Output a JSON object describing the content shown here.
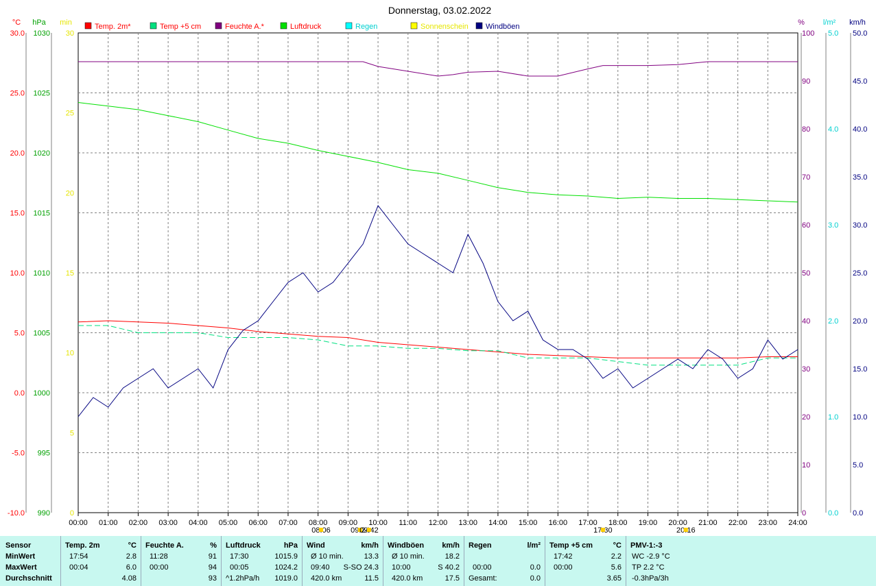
{
  "chart_data": {
    "type": "line",
    "title": "Donnerstag, 03.02.2022",
    "x_ticks": [
      "00:00",
      "01:00",
      "02:00",
      "03:00",
      "04:00",
      "05:00",
      "06:00",
      "07:00",
      "08:00",
      "09:00",
      "10:00",
      "11:00",
      "12:00",
      "13:00",
      "14:00",
      "15:00",
      "16:00",
      "17:00",
      "18:00",
      "19:00",
      "20:00",
      "21:00",
      "22:00",
      "23:00",
      "24:00"
    ],
    "axes": {
      "temp": {
        "unit": "°C",
        "min": -10,
        "max": 30,
        "ticks": [
          "30.0",
          "25.0",
          "20.0",
          "15.0",
          "10.0",
          "5.0",
          "0.0",
          "-5.0",
          "-10.0"
        ],
        "color": "#ff0000"
      },
      "pressure": {
        "unit": "hPa",
        "min": 990,
        "max": 1030,
        "ticks": [
          "1030",
          "1025",
          "1020",
          "1015",
          "1010",
          "1005",
          "1000",
          "995",
          "990"
        ],
        "color": "#00a000"
      },
      "sun": {
        "unit": "min",
        "min": 0,
        "max": 30,
        "ticks": [
          "30",
          "25",
          "20",
          "15",
          "10",
          "5",
          "0"
        ],
        "color": "#e6e600"
      },
      "humidity": {
        "unit": "%",
        "min": 0,
        "max": 100,
        "ticks": [
          "100",
          "90",
          "80",
          "70",
          "60",
          "50",
          "40",
          "30",
          "20",
          "10",
          "0"
        ],
        "color": "#800080"
      },
      "rain": {
        "unit": "l/m²",
        "min": 0,
        "max": 5,
        "ticks": [
          "5.0",
          "4.0",
          "3.0",
          "2.0",
          "1.0",
          "0.0"
        ],
        "color": "#00d0d0"
      },
      "wind": {
        "unit": "km/h",
        "min": 0,
        "max": 50,
        "ticks": [
          "50.0",
          "45.0",
          "40.0",
          "35.0",
          "30.0",
          "25.0",
          "20.0",
          "15.0",
          "10.0",
          "5.0",
          "0.0"
        ],
        "color": "#000080"
      }
    },
    "legend": [
      {
        "name": "Temp. 2m*",
        "color": "#ff0000",
        "text_color": "#ff0000"
      },
      {
        "name": "Temp +5 cm",
        "color": "#00e080",
        "text_color": "#ff0000"
      },
      {
        "name": "Feuchte A.*",
        "color": "#800080",
        "text_color": "#ff0000"
      },
      {
        "name": "Luftdruck",
        "color": "#00e000",
        "text_color": "#ff0000"
      },
      {
        "name": "Regen",
        "color": "#00ffff",
        "text_color": "#00d0d0"
      },
      {
        "name": "Sonnenschein",
        "color": "#ffff00",
        "text_color": "#e6e600"
      },
      {
        "name": "Windböen",
        "color": "#000080",
        "text_color": "#000080"
      }
    ],
    "series": [
      {
        "name": "Temp. 2m*",
        "axis": "temp",
        "color": "#ff0000",
        "x": [
          0,
          1,
          2,
          3,
          4,
          5,
          6,
          7,
          8,
          9,
          10,
          11,
          12,
          13,
          14,
          15,
          16,
          17,
          18,
          19,
          20,
          21,
          22,
          23,
          24
        ],
        "values": [
          5.9,
          6.0,
          5.9,
          5.8,
          5.6,
          5.4,
          5.1,
          4.9,
          4.7,
          4.6,
          4.2,
          4.0,
          3.8,
          3.6,
          3.4,
          3.2,
          3.1,
          3.0,
          2.9,
          2.9,
          2.9,
          2.9,
          2.9,
          3.0,
          3.0
        ]
      },
      {
        "name": "Temp +5 cm",
        "axis": "temp",
        "color": "#00e080",
        "x": [
          0,
          1,
          2,
          3,
          4,
          5,
          6,
          7,
          8,
          9,
          10,
          11,
          12,
          13,
          14,
          15,
          16,
          17,
          18,
          19,
          20,
          21,
          22,
          23,
          24
        ],
        "values": [
          5.6,
          5.6,
          5.0,
          5.0,
          5.0,
          4.6,
          4.6,
          4.6,
          4.4,
          3.9,
          3.9,
          3.7,
          3.7,
          3.5,
          3.5,
          2.9,
          2.9,
          2.9,
          2.6,
          2.3,
          2.3,
          2.3,
          2.3,
          2.9,
          2.9
        ]
      },
      {
        "name": "Feuchte A.*",
        "axis": "humidity",
        "color": "#800080",
        "x": [
          0,
          1,
          2,
          3,
          4,
          5,
          6,
          7,
          8,
          9,
          9.5,
          10,
          11,
          12,
          12.5,
          13,
          14,
          15,
          16,
          17,
          17.5,
          18,
          19,
          20,
          20.5,
          21,
          22,
          23,
          24
        ],
        "values": [
          94,
          94,
          94,
          94,
          94,
          94,
          94,
          94,
          94,
          94,
          94,
          93,
          92,
          91,
          91.3,
          91.8,
          92,
          91,
          91,
          92.5,
          93.2,
          93.2,
          93.2,
          93.4,
          93.7,
          94,
          94,
          94,
          94
        ]
      },
      {
        "name": "Luftdruck",
        "axis": "pressure",
        "color": "#00e000",
        "x": [
          0,
          1,
          2,
          3,
          4,
          5,
          6,
          7,
          8,
          9,
          10,
          11,
          12,
          13,
          14,
          15,
          16,
          17,
          18,
          19,
          20,
          21,
          22,
          23,
          24
        ],
        "values": [
          1024.2,
          1023.9,
          1023.6,
          1023.1,
          1022.6,
          1021.9,
          1021.2,
          1020.8,
          1020.2,
          1019.7,
          1019.2,
          1018.6,
          1018.3,
          1017.7,
          1017.1,
          1016.7,
          1016.5,
          1016.4,
          1016.2,
          1016.3,
          1016.2,
          1016.2,
          1016.1,
          1016.0,
          1015.9
        ]
      },
      {
        "name": "Windböen",
        "axis": "wind",
        "color": "#000080",
        "x": [
          0,
          0.5,
          1,
          1.5,
          2,
          2.5,
          3,
          3.5,
          4,
          4.5,
          5,
          5.5,
          6,
          6.5,
          7,
          7.5,
          8,
          8.5,
          9,
          9.5,
          10,
          10.5,
          11,
          11.5,
          12,
          12.5,
          13,
          13.5,
          14,
          14.5,
          15,
          15.5,
          16,
          16.5,
          17,
          17.5,
          18,
          18.5,
          19,
          19.5,
          20,
          20.5,
          21,
          21.5,
          22,
          22.5,
          23,
          23.5,
          24
        ],
        "values": [
          10,
          12,
          11,
          13,
          14,
          15,
          13,
          14,
          15,
          13,
          17,
          19,
          20,
          22,
          24,
          25,
          23,
          24,
          26,
          28,
          32,
          30,
          28,
          27,
          26,
          25,
          29,
          26,
          22,
          20,
          21,
          18,
          17,
          17,
          16,
          14,
          15,
          13,
          14,
          15,
          16,
          15,
          17,
          16,
          14,
          15,
          18,
          16,
          17
        ]
      }
    ],
    "markers": [
      {
        "time": "09:24",
        "label": "09:24"
      },
      {
        "time": "08:06",
        "label": "08:06"
      },
      {
        "time": "09:42",
        "label": "09:42"
      },
      {
        "time": "17:30",
        "label": "17:30"
      },
      {
        "time": "20:16",
        "label": "20:16"
      }
    ]
  },
  "stats": {
    "sensor": {
      "head": "Sensor",
      "rows": [
        "MinWert",
        "MaxWert",
        "Durchschnitt"
      ]
    },
    "temp2m": {
      "head": "Temp. 2m",
      "unit": "°C",
      "rows": [
        [
          "17:54",
          "2.8"
        ],
        [
          "00:04",
          "6.0"
        ],
        [
          "",
          "4.08"
        ]
      ]
    },
    "humidity": {
      "head": "Feuchte A.",
      "unit": "%",
      "rows": [
        [
          "11:28",
          "91"
        ],
        [
          "00:00",
          "94"
        ],
        [
          "",
          "93"
        ]
      ]
    },
    "pressure": {
      "head": "Luftdruck",
      "unit": "hPa",
      "rows": [
        [
          "17:30",
          "1015.9"
        ],
        [
          "00:05",
          "1024.2"
        ],
        [
          "^1.2hPa/h",
          "1019.0"
        ]
      ]
    },
    "wind": {
      "head": "Wind",
      "unit": "km/h",
      "rows": [
        [
          "Ø 10 min.",
          "13.3"
        ],
        [
          "09:40",
          "S-SO 24.3"
        ],
        [
          "420.0 km",
          "11.5"
        ]
      ]
    },
    "gusts": {
      "head": "Windböen",
      "unit": "km/h",
      "rows": [
        [
          "Ø 10 min.",
          "18.2"
        ],
        [
          "10:00",
          "S 40.2"
        ],
        [
          "420.0 km",
          "17.5"
        ]
      ]
    },
    "rain": {
      "head": "Regen",
      "unit": "l/m²",
      "rows": [
        [
          "",
          ""
        ],
        [
          "00:00",
          "0.0"
        ],
        [
          "Gesamt:",
          "0.0"
        ]
      ]
    },
    "temp5": {
      "head": "Temp +5 cm",
      "unit": "°C",
      "rows": [
        [
          "17:42",
          "2.2"
        ],
        [
          "00:00",
          "5.6"
        ],
        [
          "",
          "3.65"
        ]
      ]
    },
    "pmv": {
      "head": "PMV-1:-3",
      "rows": [
        "WC -2.9 °C",
        "TP 2.2 °C",
        "-0.3hPa/3h"
      ]
    },
    "rain_extra": "0.0"
  }
}
